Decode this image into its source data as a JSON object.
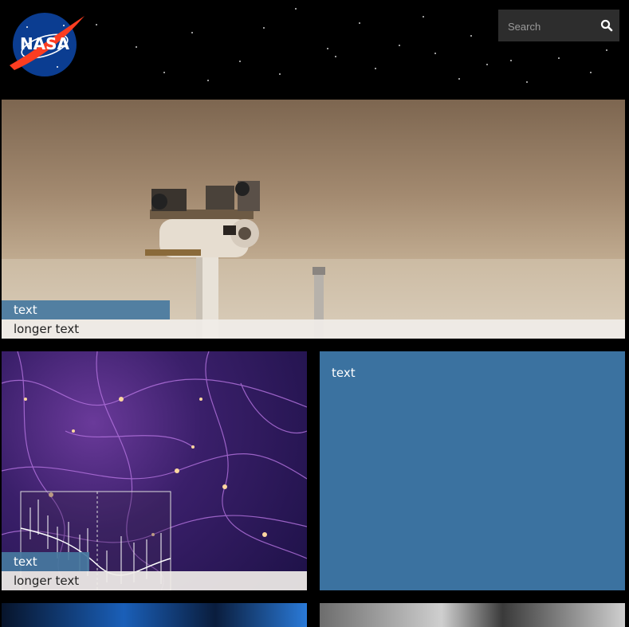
{
  "header": {
    "logo_text": "NASA",
    "search": {
      "placeholder": "Search"
    }
  },
  "tiles": [
    {
      "id": "hero",
      "short_label": "text",
      "long_label": "longer text"
    },
    {
      "id": "cosmic",
      "short_label": "text",
      "long_label": "longer text"
    },
    {
      "id": "blue",
      "text": "text"
    }
  ],
  "colors": {
    "background": "#000000",
    "tile_blue": "#3b72a0",
    "label_blue": "#4678a0",
    "label_light": "#f0ede8",
    "search_bg": "#2d2d2d"
  },
  "icons": {
    "logo": "nasa-meatball-logo",
    "search": "search-icon"
  }
}
